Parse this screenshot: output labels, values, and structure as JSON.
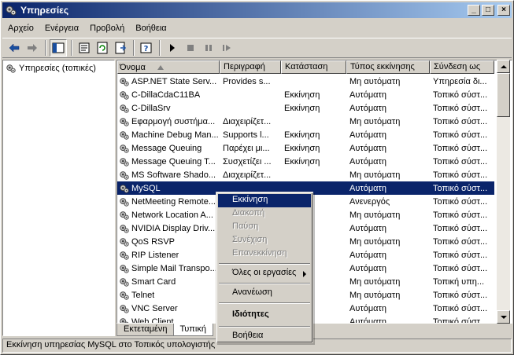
{
  "window": {
    "title": "Υπηρεσίες",
    "buttons": [
      "_",
      "□",
      "×"
    ]
  },
  "menubar": {
    "items": [
      "Αρχείο",
      "Ενέργεια",
      "Προβολή",
      "Βοήθεια"
    ]
  },
  "toolbar": {
    "tools": [
      "back-arrow-icon",
      "forward-arrow-icon",
      "show-tree-icon",
      "properties-icon",
      "refresh-icon",
      "export-list-icon",
      "help-icon",
      "play-icon",
      "stop-icon",
      "pause-icon",
      "restart-icon"
    ]
  },
  "tree": {
    "root_label": "Υπηρεσίες (τοπικές)"
  },
  "list": {
    "columns": [
      "Όνομα",
      "Περιγραφή",
      "Κατάσταση",
      "Τύπος εκκίνησης",
      "Σύνδεση ως"
    ],
    "rows": [
      {
        "name": "ASP.NET State Serv...",
        "desc": "Provides s...",
        "status": "",
        "startup": "Μη αυτόματη",
        "logon": "Υπηρεσία δι..."
      },
      {
        "name": "C-DillaCdaC11BA",
        "desc": "",
        "status": "Εκκίνηση",
        "startup": "Αυτόματη",
        "logon": "Τοπικό σύστ..."
      },
      {
        "name": "C-DillaSrv",
        "desc": "",
        "status": "Εκκίνηση",
        "startup": "Αυτόματη",
        "logon": "Τοπικό σύστ..."
      },
      {
        "name": "Εφαρμογή συστήμα...",
        "desc": "Διαχειρίζετ...",
        "status": "",
        "startup": "Μη αυτόματη",
        "logon": "Τοπικό σύστ..."
      },
      {
        "name": "Machine Debug Man...",
        "desc": "Supports l...",
        "status": "Εκκίνηση",
        "startup": "Αυτόματη",
        "logon": "Τοπικό σύστ..."
      },
      {
        "name": "Message Queuing",
        "desc": "Παρέχει μι...",
        "status": "Εκκίνηση",
        "startup": "Αυτόματη",
        "logon": "Τοπικό σύστ..."
      },
      {
        "name": "Message Queuing T...",
        "desc": "Συσχετίζει ...",
        "status": "Εκκίνηση",
        "startup": "Αυτόματη",
        "logon": "Τοπικό σύστ..."
      },
      {
        "name": "MS Software Shado...",
        "desc": "Διαχειρίζετ...",
        "status": "",
        "startup": "Μη αυτόματη",
        "logon": "Τοπικό σύστ..."
      },
      {
        "name": "MySQL",
        "desc": "",
        "status": "",
        "startup": "Αυτόματη",
        "logon": "Τοπικό σύστ..."
      },
      {
        "name": "NetMeeting Remote...",
        "desc": "",
        "status": "",
        "startup": "Ανενεργός",
        "logon": "Τοπικό σύστ..."
      },
      {
        "name": "Network Location A...",
        "desc": "",
        "status": "...",
        "startup": "Μη αυτόματη",
        "logon": "Τοπικό σύστ..."
      },
      {
        "name": "NVIDIA Display Driv...",
        "desc": "",
        "status": "...",
        "startup": "Αυτόματη",
        "logon": "Τοπικό σύστ..."
      },
      {
        "name": "QoS RSVP",
        "desc": "",
        "status": "...",
        "startup": "Μη αυτόματη",
        "logon": "Τοπικό σύστ..."
      },
      {
        "name": "RIP Listener",
        "desc": "",
        "status": "...",
        "startup": "Αυτόματη",
        "logon": "Τοπικό σύστ..."
      },
      {
        "name": "Simple Mail Transpo...",
        "desc": "",
        "status": "...",
        "startup": "Αυτόματη",
        "logon": "Τοπικό σύστ..."
      },
      {
        "name": "Smart Card",
        "desc": "",
        "status": "",
        "startup": "Μη αυτόματη",
        "logon": "Τοπική υπη..."
      },
      {
        "name": "Telnet",
        "desc": "",
        "status": "",
        "startup": "Μη αυτόματη",
        "logon": "Τοπικό σύστ..."
      },
      {
        "name": "VNC Server",
        "desc": "",
        "status": "...",
        "startup": "Αυτόματη",
        "logon": "Τοπικό σύστ..."
      },
      {
        "name": "Web Client",
        "desc": "",
        "status": "",
        "startup": "Αυτόματη",
        "logon": "Τοπικό σύστ..."
      }
    ],
    "selected_index": 8
  },
  "tabs": [
    "Εκτεταμένη",
    "Τυπική"
  ],
  "statusbar": {
    "text": "Εκκίνηση υπηρεσίας MySQL στο Τοπικός υπολογιστής"
  },
  "context_menu": {
    "start": "Εκκίνηση",
    "stop": "Διακοπή",
    "pause": "Παύση",
    "resume": "Συνέχιση",
    "restart": "Επανεκκίνηση",
    "all_tasks": "Όλες οι εργασίες",
    "refresh": "Ανανέωση",
    "properties": "Ιδιότητες",
    "help": "Βοήθεια"
  }
}
